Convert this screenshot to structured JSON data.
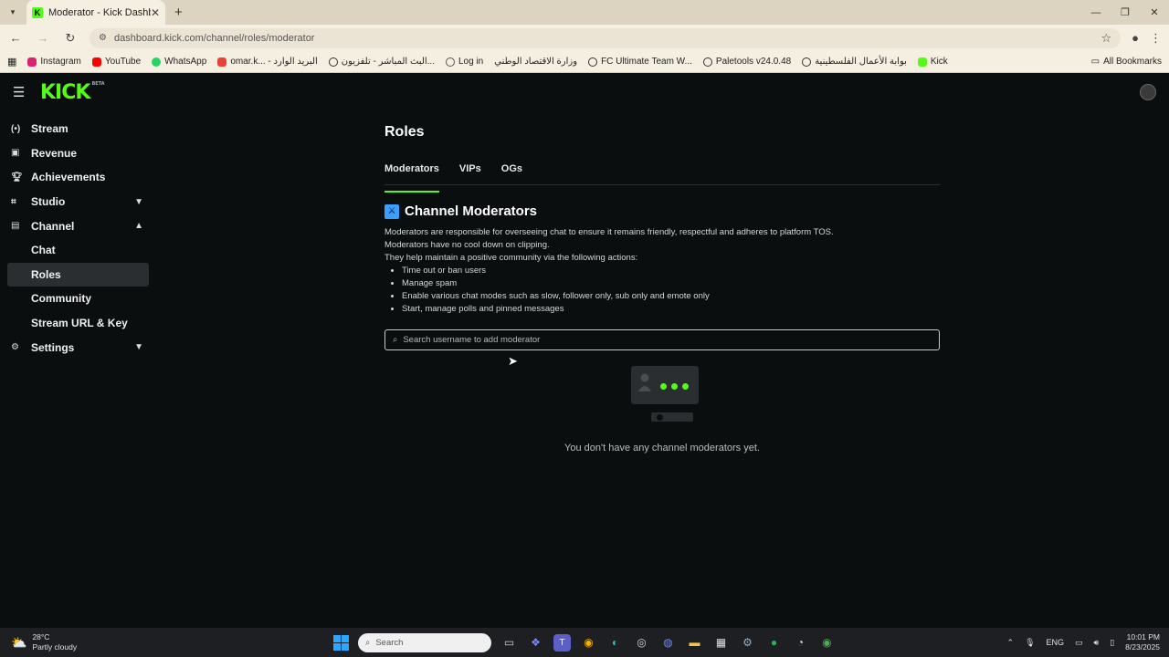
{
  "browser": {
    "tab_title": "Moderator - Kick Dashboard",
    "url": "dashboard.kick.com/channel/roles/moderator",
    "bookmarks": [
      "Instagram",
      "YouTube",
      "WhatsApp",
      "omar.k... - البريد الوارد",
      "البث المباشر - تلفزيون...",
      "Log in",
      "وزارة الاقتصاد الوطني",
      "FC Ultimate Team W...",
      "Paletools v24.0.48",
      "بوابة الأعمال الفلسطينية",
      "Kick"
    ],
    "all_bookmarks": "All Bookmarks"
  },
  "app": {
    "logo": "KICK",
    "logo_badge": "BETA"
  },
  "sidebar": {
    "items": [
      {
        "label": "Stream",
        "icon": "stream-icon"
      },
      {
        "label": "Revenue",
        "icon": "revenue-icon"
      },
      {
        "label": "Achievements",
        "icon": "trophy-icon"
      },
      {
        "label": "Studio",
        "icon": "studio-icon"
      },
      {
        "label": "Channel",
        "icon": "channel-icon"
      },
      {
        "label": "Chat"
      },
      {
        "label": "Roles"
      },
      {
        "label": "Community"
      },
      {
        "label": "Stream URL & Key"
      },
      {
        "label": "Settings",
        "icon": "gear-icon"
      }
    ]
  },
  "main": {
    "title": "Roles",
    "tabs": [
      "Moderators",
      "VIPs",
      "OGs"
    ],
    "section_title": "Channel Moderators",
    "description": [
      "Moderators are responsible for overseeing chat to ensure it remains friendly, respectful and adheres to platform TOS.",
      "Moderators have no cool down on clipping.",
      "They help maintain a positive community via the following actions:"
    ],
    "bullets": [
      "Time out or ban users",
      "Manage spam",
      "Enable various chat modes such as slow, follower only, sub only and emote only",
      "Start, manage polls and pinned messages"
    ],
    "search_placeholder": "Search username to add moderator",
    "empty_text": "You don't have any channel moderators yet."
  },
  "taskbar": {
    "temperature": "28°C",
    "weather": "Partly cloudy",
    "search": "Search",
    "lang": "ENG",
    "time": "10:01 PM",
    "date": "8/23/2025"
  },
  "colors": {
    "accent": "#53fc18",
    "background": "#0b0e0f"
  }
}
